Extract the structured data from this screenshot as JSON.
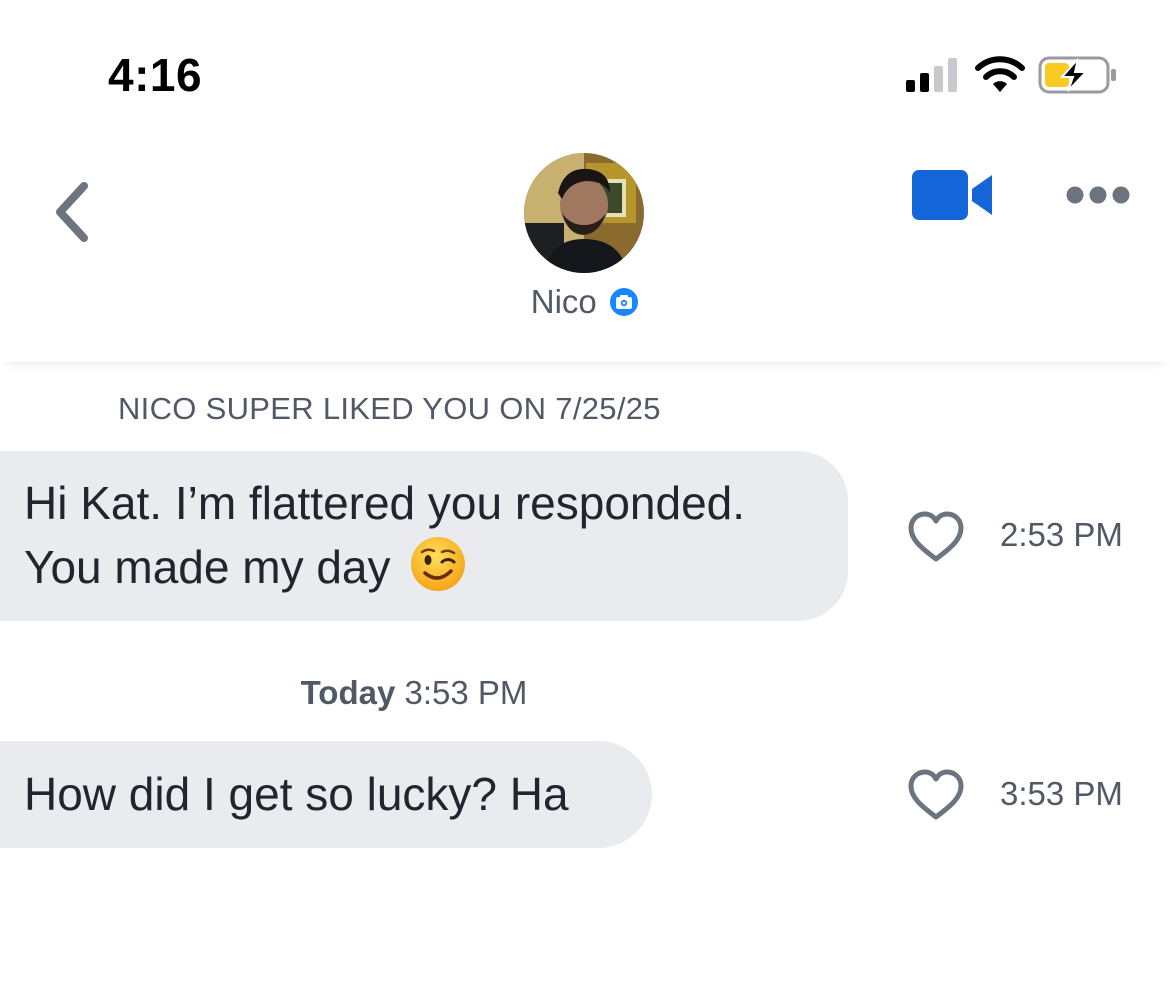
{
  "status_bar": {
    "time": "4:16"
  },
  "header": {
    "name": "Nico",
    "verified_icon": "camera-badge-icon"
  },
  "colors": {
    "accent": "#1466d8",
    "badge": "#1786ff",
    "bubble": "#e9ebef",
    "muted": "#505965",
    "battery": "#f7cb22"
  },
  "conversation": {
    "super_like_notice": "NICO SUPER LIKED YOU ON 7/25/25",
    "messages": [
      {
        "text_line1": "Hi Kat. I’m flattered you responded.",
        "text_line2": "You made my day",
        "emoji": "😉",
        "time": "2:53 PM"
      },
      {
        "text": "How did I get so lucky? Ha",
        "time": "3:53 PM"
      }
    ],
    "separator": {
      "day": "Today",
      "time": "3:53 PM"
    }
  }
}
